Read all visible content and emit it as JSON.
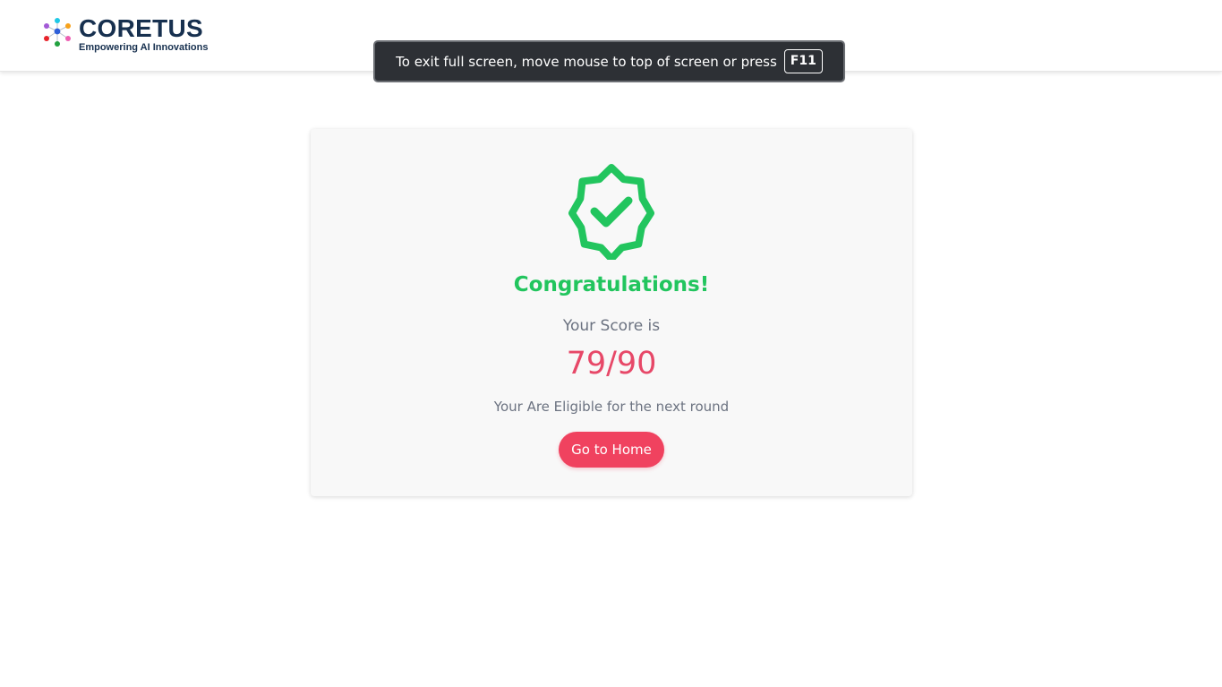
{
  "header": {
    "brand_name": "CORETUS",
    "brand_tagline": "Empowering AI Innovations",
    "logo_icon": "network-dots-icon"
  },
  "fullscreen_notice": {
    "message": "To exit full screen, move mouse to top of screen or press",
    "key": "F11"
  },
  "result": {
    "icon": "check-badge-icon",
    "heading": "Congratulations!",
    "score_label": "Your Score is",
    "score": "79/90",
    "eligibility": "Your Are Eligible for the next round",
    "home_button": "Go to Home"
  },
  "colors": {
    "success": "#22c55e",
    "accent": "#f0425f",
    "score": "#e74868",
    "brand": "#17304f",
    "muted_text": "#6b7280"
  }
}
